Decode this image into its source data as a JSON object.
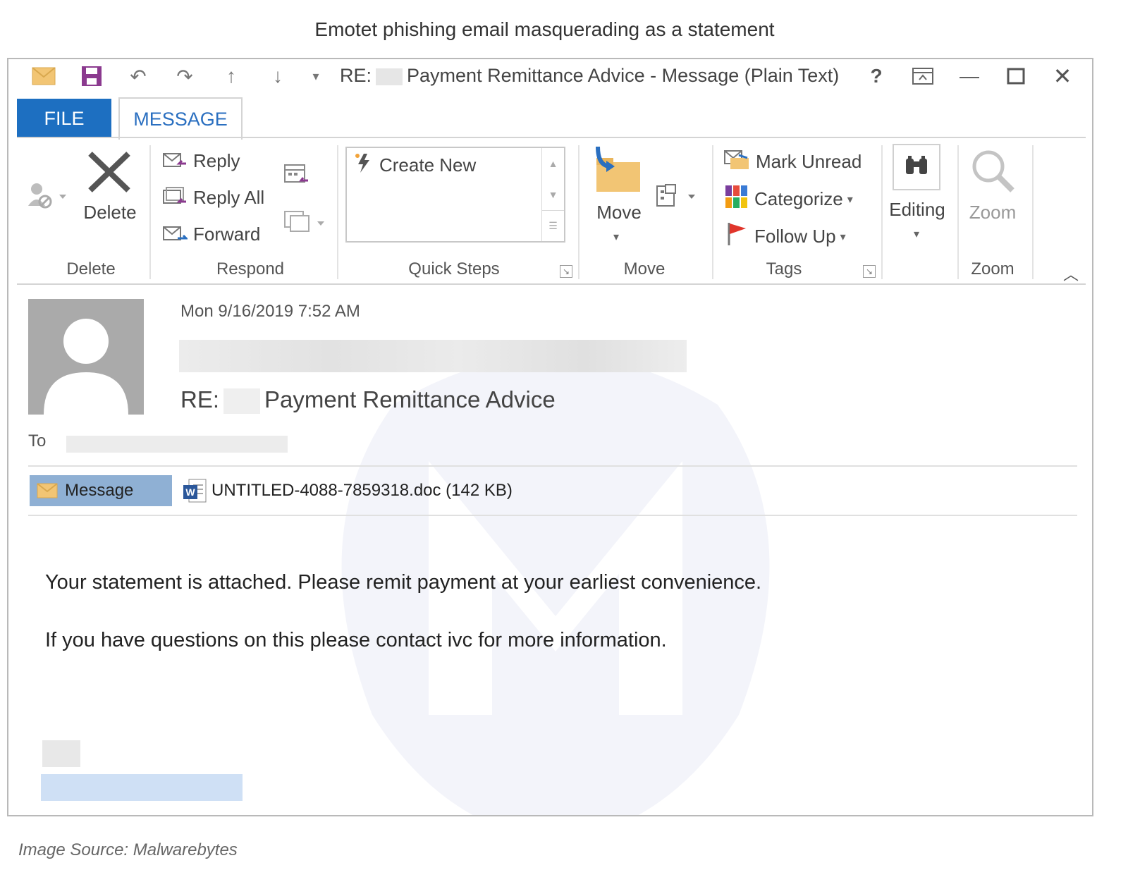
{
  "caption": "Emotet phishing email masquerading as a statement",
  "source": "Image Source: Malwarebytes",
  "window": {
    "title_prefix": "RE:",
    "title_suffix": "Payment Remittance Advice - Message (Plain Text)",
    "help": "?",
    "controls": [
      "restore-ribbon-icon",
      "minimize-icon",
      "maximize-icon",
      "close-icon"
    ]
  },
  "tabs": {
    "file": "FILE",
    "message": "MESSAGE"
  },
  "ribbon": {
    "delete_group": {
      "label": "Delete",
      "delete": "Delete"
    },
    "respond_group": {
      "label": "Respond",
      "reply": "Reply",
      "reply_all": "Reply All",
      "forward": "Forward"
    },
    "quicksteps_group": {
      "label": "Quick Steps",
      "create_new": "Create New"
    },
    "move_group": {
      "label": "Move",
      "move": "Move"
    },
    "tags_group": {
      "label": "Tags",
      "mark_unread": "Mark Unread",
      "categorize": "Categorize",
      "follow_up": "Follow Up"
    },
    "editing": {
      "label": "Editing"
    },
    "zoom_group": {
      "label": "Zoom",
      "zoom": "Zoom"
    }
  },
  "message": {
    "date": "Mon 9/16/2019 7:52 AM",
    "subject_prefix": "RE:",
    "subject_suffix": "Payment Remittance Advice",
    "to_label": "To",
    "message_tab": "Message",
    "attachment": "UNTITLED-4088-7859318.doc (142 KB)",
    "body": [
      "Your statement is attached. Please remit payment at your earliest convenience.",
      "If you have questions on this please contact ivc for more information."
    ]
  },
  "colors": {
    "file_tab": "#1d6fc1",
    "message_tab_text": "#2a6fc0",
    "msg_button": "#8fb0d4"
  }
}
